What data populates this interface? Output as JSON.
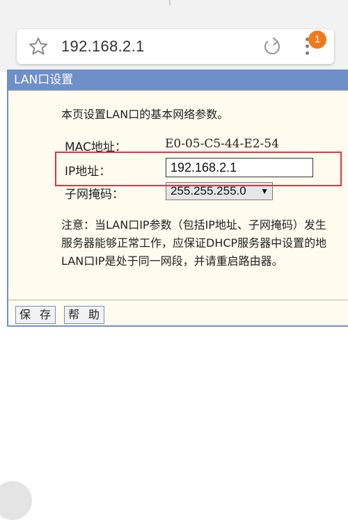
{
  "browser": {
    "url": "192.168.2.1",
    "notification_count": "1",
    "icons": {
      "bookmark": "star-outline-icon",
      "reload": "reload-icon",
      "menu": "more-vertical-icon"
    },
    "badge_color": "#f07a1a"
  },
  "router": {
    "header_title": "LAN口设置",
    "header_color": "#6f8fc8",
    "intro": "本页设置LAN口的基本网络参数。",
    "fields": {
      "mac_label": "MAC地址：",
      "mac_value": "E0-05-C5-44-E2-54",
      "ip_label": "IP地址：",
      "ip_value": "192.168.2.1",
      "mask_label": "子网掩码：",
      "mask_value": "255.255.255.0"
    },
    "note_lines": [
      "注意：当LAN口IP参数（包括IP地址、子网掩码）发生",
      "服务器能够正常工作，应保证DHCP服务器中设置的地",
      "LAN口IP是处于同一网段，并请重启路由器。"
    ],
    "buttons": {
      "save": "保 存",
      "help": "帮 助"
    },
    "highlight_color": "#e03344"
  }
}
